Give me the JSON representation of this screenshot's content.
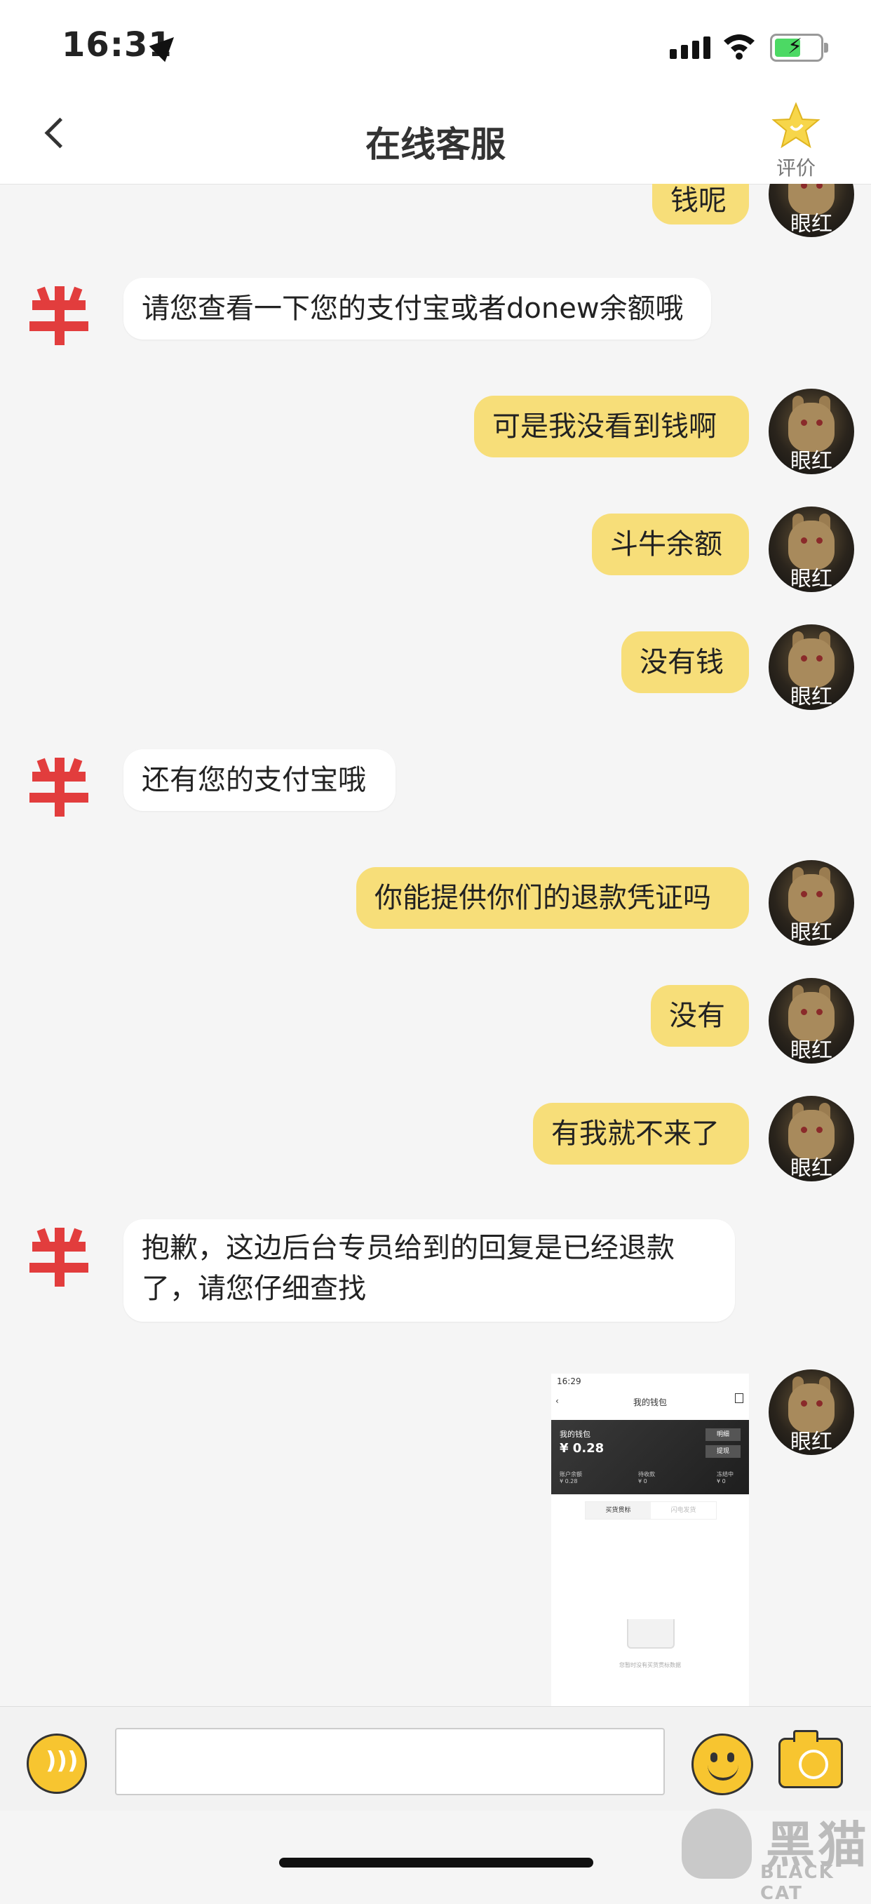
{
  "status_bar": {
    "time": "16:31"
  },
  "nav": {
    "title": "在线客服",
    "rate_label": "评价"
  },
  "avatar_name": "眼红",
  "messages": [
    {
      "side": "right",
      "text": "钱呢"
    },
    {
      "side": "left",
      "text": "请您查看一下您的支付宝或者donew余额哦"
    },
    {
      "side": "right",
      "text": "可是我没看到钱啊"
    },
    {
      "side": "right",
      "text": "斗牛余额"
    },
    {
      "side": "right",
      "text": "没有钱"
    },
    {
      "side": "left",
      "text": "还有您的支付宝哦"
    },
    {
      "side": "right",
      "text": "你能提供你们的退款凭证吗"
    },
    {
      "side": "right",
      "text": "没有"
    },
    {
      "side": "right",
      "text": "有我就不来了"
    },
    {
      "side": "left",
      "text_line1": "抱歉，这边后台专员给到的回复是已经退款",
      "text_line2": "了，请您仔细查找"
    }
  ],
  "screenshot_message": {
    "time": "16:29",
    "title": "我的钱包",
    "wallet_label": "我的钱包",
    "amount": "¥ 0.28",
    "btn1": "明细",
    "btn2": "提现",
    "col1_label": "账户余额",
    "col1_value": "¥ 0.28",
    "col2_label": "待收款",
    "col2_value": "¥ 0",
    "col3_label": "冻结中",
    "col3_value": "¥ 0",
    "tab1": "买货贯标",
    "tab2": "闪电发货",
    "empty_text": "您暂时没有买货贯标数据"
  },
  "input_bar": {
    "placeholder": ""
  },
  "watermark": {
    "title": "黑猫",
    "subtitle": "BLACK CAT"
  },
  "colors": {
    "bubble_user": "#f7de79",
    "bubble_agent": "#ffffff",
    "accent": "#f7c530"
  }
}
